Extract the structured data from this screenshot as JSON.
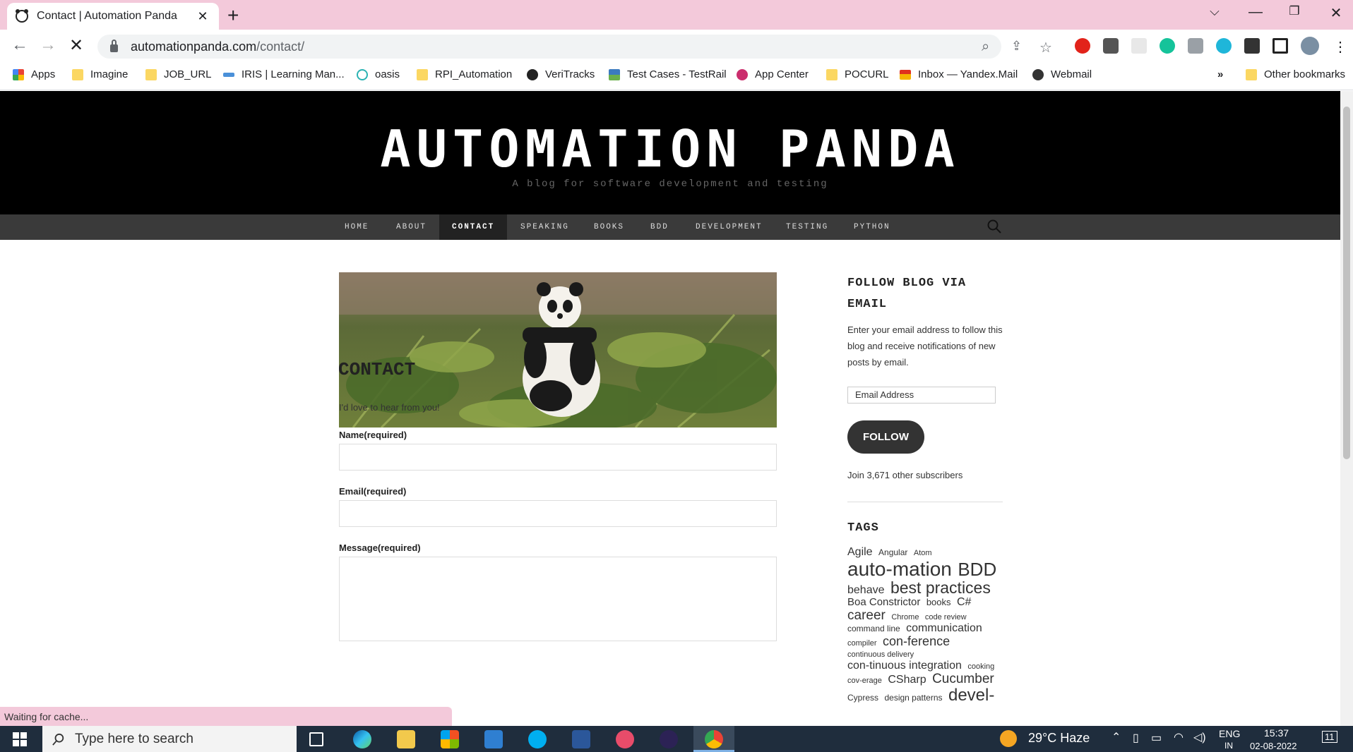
{
  "browser": {
    "tab_title": "Contact | Automation Panda",
    "new_tab": "+",
    "close": "✕",
    "url_domain": "automationpanda.com",
    "url_path": "/contact/",
    "window_controls": [
      "⌵",
      "—",
      "❐",
      "✕"
    ]
  },
  "bookmarks": [
    {
      "label": "Apps",
      "icon": "apps-grid-icon"
    },
    {
      "label": "Imagine",
      "icon": "folder-icon"
    },
    {
      "label": "JOB_URL",
      "icon": "folder-icon"
    },
    {
      "label": "IRIS | Learning Man...",
      "icon": "iris-icon"
    },
    {
      "label": "oasis",
      "icon": "oasis-icon"
    },
    {
      "label": "RPI_Automation",
      "icon": "folder-icon"
    },
    {
      "label": "VeriTracks",
      "icon": "veritracks-icon"
    },
    {
      "label": "Test Cases - TestRail",
      "icon": "testrail-icon"
    },
    {
      "label": "App Center",
      "icon": "appcenter-icon"
    },
    {
      "label": "POCURL",
      "icon": "folder-icon"
    },
    {
      "label": "Inbox — Yandex.Mail",
      "icon": "mail-icon"
    },
    {
      "label": "Webmail",
      "icon": "wordpress-icon"
    }
  ],
  "bookmarks_overflow": "»",
  "other_bookmarks": "Other bookmarks",
  "site": {
    "title": "AUTOMATION PANDA",
    "description": "A blog for software development and testing",
    "nav": [
      "HOME",
      "ABOUT",
      "CONTACT",
      "SPEAKING",
      "BOOKS",
      "BDD",
      "DEVELOPMENT",
      "TESTING",
      "PYTHON"
    ],
    "active_nav": "CONTACT"
  },
  "content": {
    "heading": "CONTACT",
    "intro": "I'd love to hear from you!",
    "fields": {
      "name_label": "Name(required)",
      "email_label": "Email(required)",
      "message_label": "Message(required)"
    }
  },
  "sidebar": {
    "follow_title": "FOLLOW BLOG VIA EMAIL",
    "follow_text": "Enter your email address to follow this blog and receive notifications of new posts by email.",
    "email_placeholder": "Email Address",
    "follow_button": "FOLLOW",
    "subscribers": "Join 3,671 other subscribers",
    "tags_title": "TAGS",
    "tags": [
      {
        "text": "Agile",
        "size": 16
      },
      {
        "text": "Angular",
        "size": 12
      },
      {
        "text": "Atom",
        "size": 11
      },
      {
        "text": "auto-mation",
        "size": 28
      },
      {
        "text": "BDD",
        "size": 26
      },
      {
        "text": "behave",
        "size": 16
      },
      {
        "text": "best practices",
        "size": 23
      },
      {
        "text": "Boa Constrictor",
        "size": 15
      },
      {
        "text": "books",
        "size": 13
      },
      {
        "text": "C#",
        "size": 16
      },
      {
        "text": "career",
        "size": 19
      },
      {
        "text": "Chrome",
        "size": 11
      },
      {
        "text": "code review",
        "size": 11
      },
      {
        "text": "command line",
        "size": 12
      },
      {
        "text": "communication",
        "size": 16
      },
      {
        "text": "compiler",
        "size": 11
      },
      {
        "text": "con-ference",
        "size": 18
      },
      {
        "text": "continuous delivery",
        "size": 11
      },
      {
        "text": "con-tinuous integration",
        "size": 16
      },
      {
        "text": "cooking",
        "size": 11
      },
      {
        "text": "cov-erage",
        "size": 11
      },
      {
        "text": "CSharp",
        "size": 16
      },
      {
        "text": "Cucumber",
        "size": 19
      },
      {
        "text": "Cypress",
        "size": 12
      },
      {
        "text": "design patterns",
        "size": 12
      },
      {
        "text": "devel-",
        "size": 24
      }
    ]
  },
  "status": "Waiting for cache...",
  "taskbar": {
    "search_placeholder": "Type here to search",
    "weather": "29°C  Haze",
    "lang": "ENG",
    "lang_sub": "IN",
    "time": "15:37",
    "date": "02-08-2022",
    "notifications": "11"
  },
  "colors": {
    "tabbar": "#f3c9da",
    "header_bg": "#000000",
    "nav_bg": "#3a3a3a",
    "button_bg": "#333333"
  }
}
